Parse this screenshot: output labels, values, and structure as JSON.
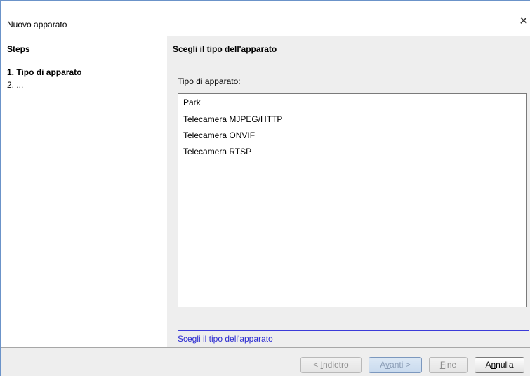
{
  "window": {
    "title": "Nuovo apparato",
    "close_glyph": "✕",
    "close_icon": "close-icon"
  },
  "steps": {
    "header": "Steps",
    "items": [
      {
        "label": "1. Tipo di apparato",
        "current": true
      },
      {
        "label": "2. ...",
        "current": false
      }
    ]
  },
  "main": {
    "header": "Scegli il tipo dell'apparato",
    "type_label": "Tipo di apparato:",
    "device_types": [
      "Park",
      "Telecamera MJPEG/HTTP",
      "Telecamera ONVIF",
      "Telecamera RTSP"
    ],
    "status_text": "Scegli il tipo dell'apparato"
  },
  "buttons": {
    "back": {
      "prefix": "< ",
      "mnemonic": "I",
      "rest": "ndietro",
      "enabled": false
    },
    "next": {
      "prefix": "A",
      "mnemonic": "v",
      "rest": "anti >",
      "enabled": false
    },
    "finish": {
      "prefix": "",
      "mnemonic": "F",
      "rest": "ine",
      "enabled": false
    },
    "cancel": {
      "prefix": "A",
      "mnemonic": "n",
      "rest": "nulla",
      "enabled": true
    }
  },
  "colors": {
    "status_text": "#2b2bd1",
    "status_rule": "#3b3bd9",
    "window_border": "#6b93c9",
    "panel_bg": "#eeeeee"
  }
}
